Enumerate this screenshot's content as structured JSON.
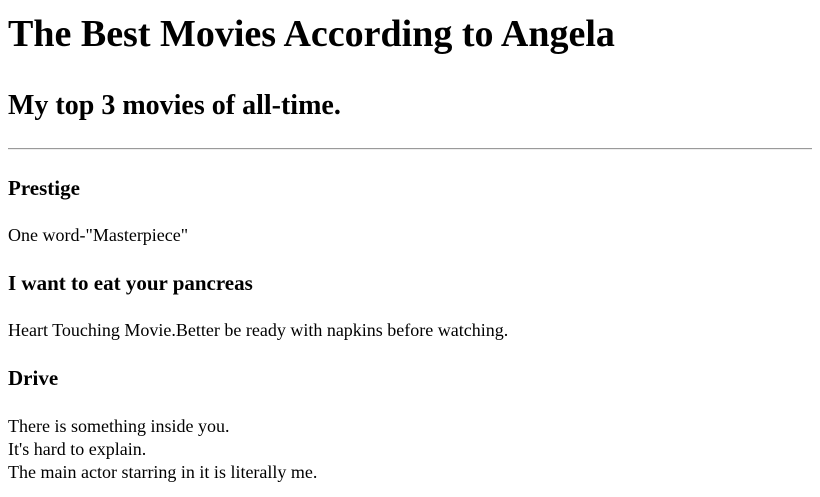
{
  "page_title": "The Best Movies According to Angela",
  "subtitle": "My top 3 movies of all-time.",
  "movies": [
    {
      "title": "Prestige",
      "description_lines": [
        "One word-\"Masterpiece\""
      ]
    },
    {
      "title": "I want to eat your pancreas",
      "description_lines": [
        "Heart Touching Movie.Better be ready with napkins before watching."
      ]
    },
    {
      "title": "Drive",
      "description_lines": [
        "There is something inside you.",
        "It's hard to explain.",
        "The main actor starring in it is literally me."
      ]
    }
  ]
}
